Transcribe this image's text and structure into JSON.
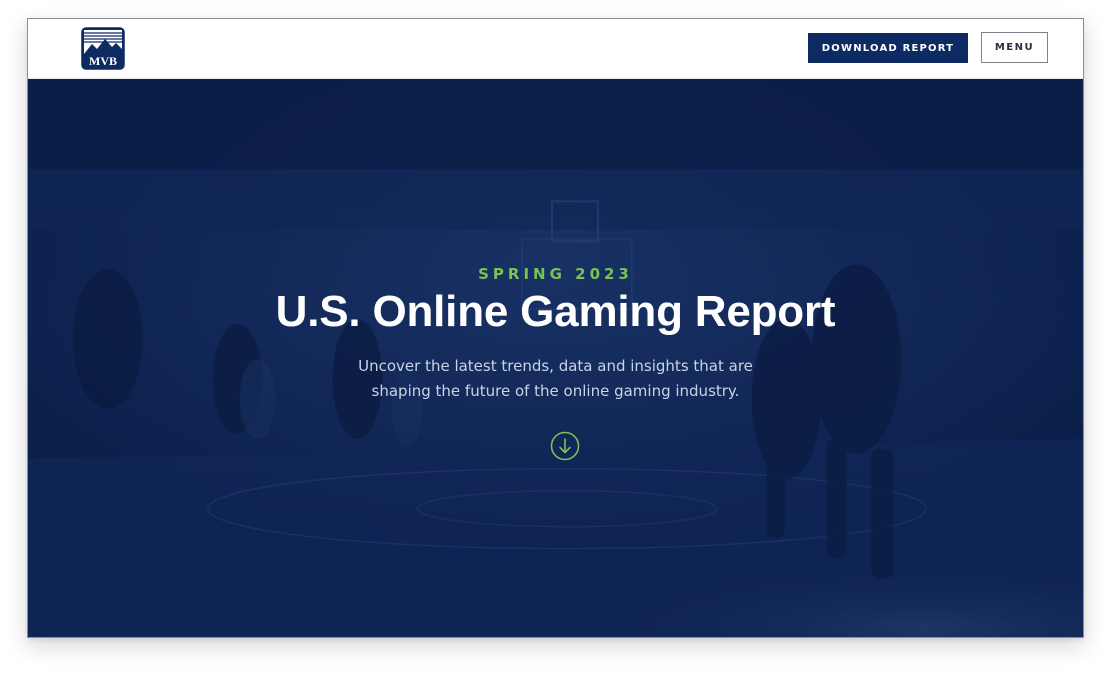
{
  "header": {
    "logo_text": "MVB",
    "download_label": "DOWNLOAD REPORT",
    "menu_label": "MENU"
  },
  "hero": {
    "eyebrow": "SPRING 2023",
    "title": "U.S. Online Gaming Report",
    "subtitle_line1": "Uncover the latest trends, data and insights that are",
    "subtitle_line2": "shaping the future of the online gaming industry.",
    "scroll_icon": "arrow-down-circle-icon"
  },
  "colors": {
    "brand_navy": "#0d2a63",
    "hero_navy": "#0d2452",
    "accent_green": "#79c254",
    "white": "#ffffff"
  }
}
